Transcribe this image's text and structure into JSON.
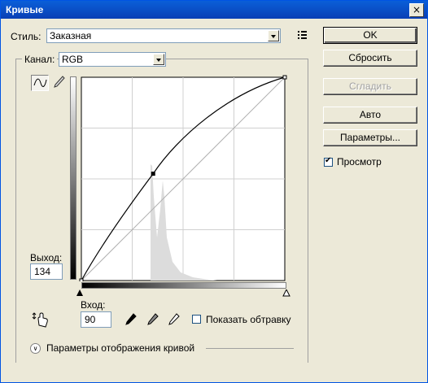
{
  "window": {
    "title": "Кривые",
    "close": "×"
  },
  "style": {
    "label": "Стиль:",
    "value": "Заказная"
  },
  "channel": {
    "label": "Канал:",
    "value": "RGB"
  },
  "buttons": {
    "ok": "OK",
    "reset": "Сбросить",
    "smooth": "Сгладить",
    "auto": "Авто",
    "options": "Параметры..."
  },
  "preview": {
    "label": "Просмотр",
    "checked": true
  },
  "output": {
    "label": "Выход:",
    "value": "134"
  },
  "input": {
    "label": "Вход:",
    "value": "90"
  },
  "clipping": {
    "label": "Показать обтравку",
    "checked": false
  },
  "display_options": {
    "label": "Параметры отображения кривой"
  },
  "curve": {
    "input_max": 255,
    "output_max": 255,
    "selected_point": {
      "input": 90,
      "output": 134
    },
    "endpoints": [
      [
        0,
        0
      ],
      [
        255,
        255
      ]
    ]
  },
  "colors": {
    "titlebar": "#0a4fc8",
    "dialog": "#ece9d8"
  }
}
